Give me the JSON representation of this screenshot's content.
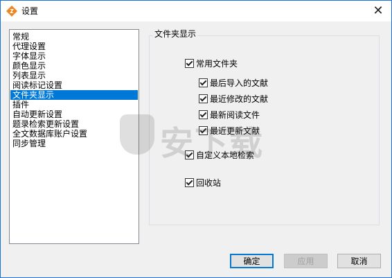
{
  "window": {
    "title": "设置",
    "close_glyph": "✕",
    "app_icon": "app-logo-icon",
    "accent_color": "#0078d7"
  },
  "sidebar": {
    "items": [
      {
        "label": "常规",
        "selected": false
      },
      {
        "label": "代理设置",
        "selected": false
      },
      {
        "label": "字体显示",
        "selected": false
      },
      {
        "label": "颜色显示",
        "selected": false
      },
      {
        "label": "列表显示",
        "selected": false
      },
      {
        "label": "阅读标记设置",
        "selected": false
      },
      {
        "label": "文件夹显示",
        "selected": true
      },
      {
        "label": "插件",
        "selected": false
      },
      {
        "label": "自动更新设置",
        "selected": false
      },
      {
        "label": "题录检索更新设置",
        "selected": false
      },
      {
        "label": "全文数据库账户设置",
        "selected": false
      },
      {
        "label": "同步管理",
        "selected": false
      }
    ]
  },
  "panel": {
    "group_title": "文件夹显示",
    "options": {
      "common_folders": {
        "label": "常用文件夹",
        "checked": true
      },
      "recent_import": {
        "label": "最后导入的文献",
        "checked": true
      },
      "recent_modified": {
        "label": "最近修改的文献",
        "checked": true
      },
      "recent_read": {
        "label": "最新阅读文件",
        "checked": true
      },
      "recent_updated": {
        "label": "最近更新文献",
        "checked": true
      },
      "custom_local_search": {
        "label": "自定义本地检索",
        "checked": true
      },
      "recycle_bin": {
        "label": "回收站",
        "checked": true
      }
    }
  },
  "buttons": {
    "ok": "确定",
    "apply": "应用",
    "cancel": "取消"
  },
  "watermark": {
    "text": "安下载"
  }
}
